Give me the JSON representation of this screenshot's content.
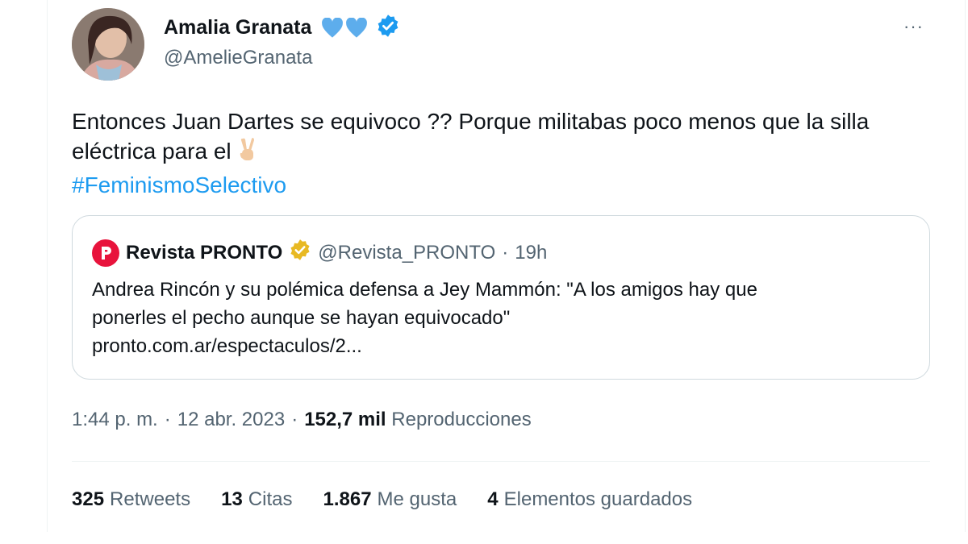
{
  "author": {
    "name": "Amalia Granata",
    "handle": "@AmelieGranata",
    "badge_icons": [
      "blue-heart-icon",
      "blue-heart-icon",
      "verified-badge-icon"
    ],
    "more_label": "···"
  },
  "tweet": {
    "text": "Entonces Juan Dartes se equivoco ?? Porque militabas poco menos que la silla eléctrica para el",
    "emoji_icon": "victory-hand-icon",
    "hashtag": "#FeminismoSelectivo"
  },
  "quote": {
    "name": "Revista PRONTO",
    "handle": "@Revista_PRONTO",
    "separator": "·",
    "time": "19h",
    "text_line1": "Andrea Rincón y su polémica defensa a Jey Mammón: \"A los amigos hay que",
    "text_line2": "ponerles el pecho aunque se hayan equivocado\"",
    "link": "pronto.com.ar/espectaculos/2..."
  },
  "meta": {
    "time": "1:44 p. m.",
    "sep1": "·",
    "date": "12 abr. 2023",
    "sep2": "·",
    "views_count": "152,7 mil",
    "views_label": "Reproducciones"
  },
  "stats": [
    {
      "count": "325",
      "label": "Retweets"
    },
    {
      "count": "13",
      "label": "Citas"
    },
    {
      "count": "1.867",
      "label": "Me gusta"
    },
    {
      "count": "4",
      "label": "Elementos guardados"
    }
  ],
  "colors": {
    "accent": "#1d9bf0",
    "secondary_text": "#536471",
    "pronto_red": "#e8133c",
    "gold_verified": "#f4c542"
  }
}
